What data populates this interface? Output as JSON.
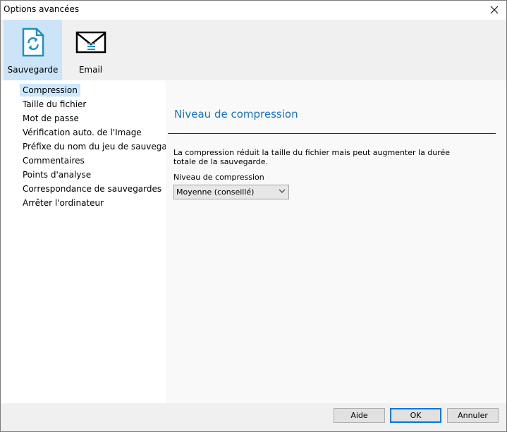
{
  "window": {
    "title": "Options avancées"
  },
  "toolbar": {
    "items": [
      {
        "label": "Sauvegarde",
        "icon": "backup-file-icon",
        "selected": true
      },
      {
        "label": "Email",
        "icon": "envelope-icon",
        "selected": false
      }
    ]
  },
  "sidebar": {
    "items": [
      {
        "label": "Compression",
        "active": true
      },
      {
        "label": "Taille du fichier"
      },
      {
        "label": "Mot de passe"
      },
      {
        "label": "Vérification auto. de l'Image"
      },
      {
        "label": "Préfixe du nom du jeu de sauvegarde"
      },
      {
        "label": "Commentaires"
      },
      {
        "label": "Points d'analyse"
      },
      {
        "label": "Correspondance de sauvegardes"
      },
      {
        "label": "Arrêter l'ordinateur"
      }
    ]
  },
  "main": {
    "section_title": "Niveau de compression",
    "description": "La compression réduit la taille du fichier mais peut augmenter la durée totale de la sauvegarde.",
    "field_label": "Niveau de compression",
    "select_value": "Moyenne (conseillé)"
  },
  "footer": {
    "help_label": "Aide",
    "ok_label": "OK",
    "cancel_label": "Annuler"
  },
  "colors": {
    "accent": "#0078d7",
    "section_title": "#1a73c2",
    "selected_tool_bg": "#cce4f7",
    "active_nav_bg": "#cce8ff",
    "icon_blue": "#1f8fc4"
  }
}
